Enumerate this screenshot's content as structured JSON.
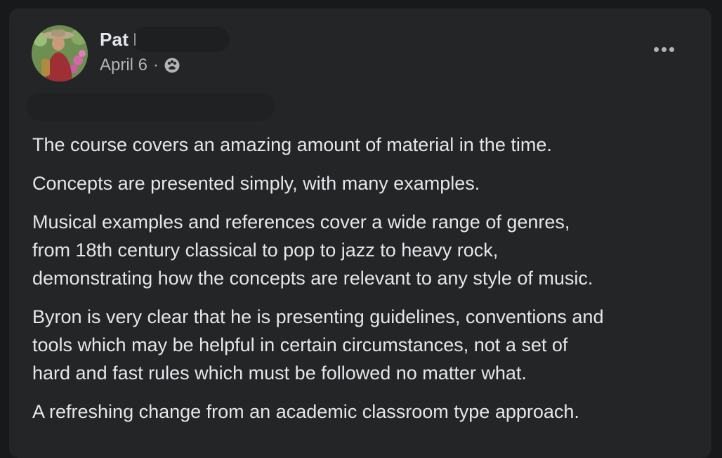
{
  "post": {
    "author": {
      "name": "Pat",
      "avatar_icon": "profile-photo"
    },
    "meta": {
      "date": "April 6",
      "separator": "·",
      "audience_icon": "friends-audience-icon"
    },
    "menu_icon": "more-options-icon",
    "paragraphs": [
      "The course covers an amazing amount of material in the time.",
      "Concepts are presented simply, with many examples.",
      "Musical examples and references cover a wide range of genres,\nfrom 18th century classical to pop to jazz to heavy rock,\ndemonstrating how the concepts are relevant to any style of music.",
      "Byron is very clear that he is presenting guidelines, conventions and\ntools which may be helpful in certain circumstances, not a set of\nhard and fast rules which must be followed no matter what.",
      "A refreshing change from an academic classroom type approach."
    ]
  },
  "colors": {
    "page_background": "#18191a",
    "card_background": "#242526",
    "primary_text": "#e4e6eb",
    "secondary_text": "#b0b3b8"
  }
}
